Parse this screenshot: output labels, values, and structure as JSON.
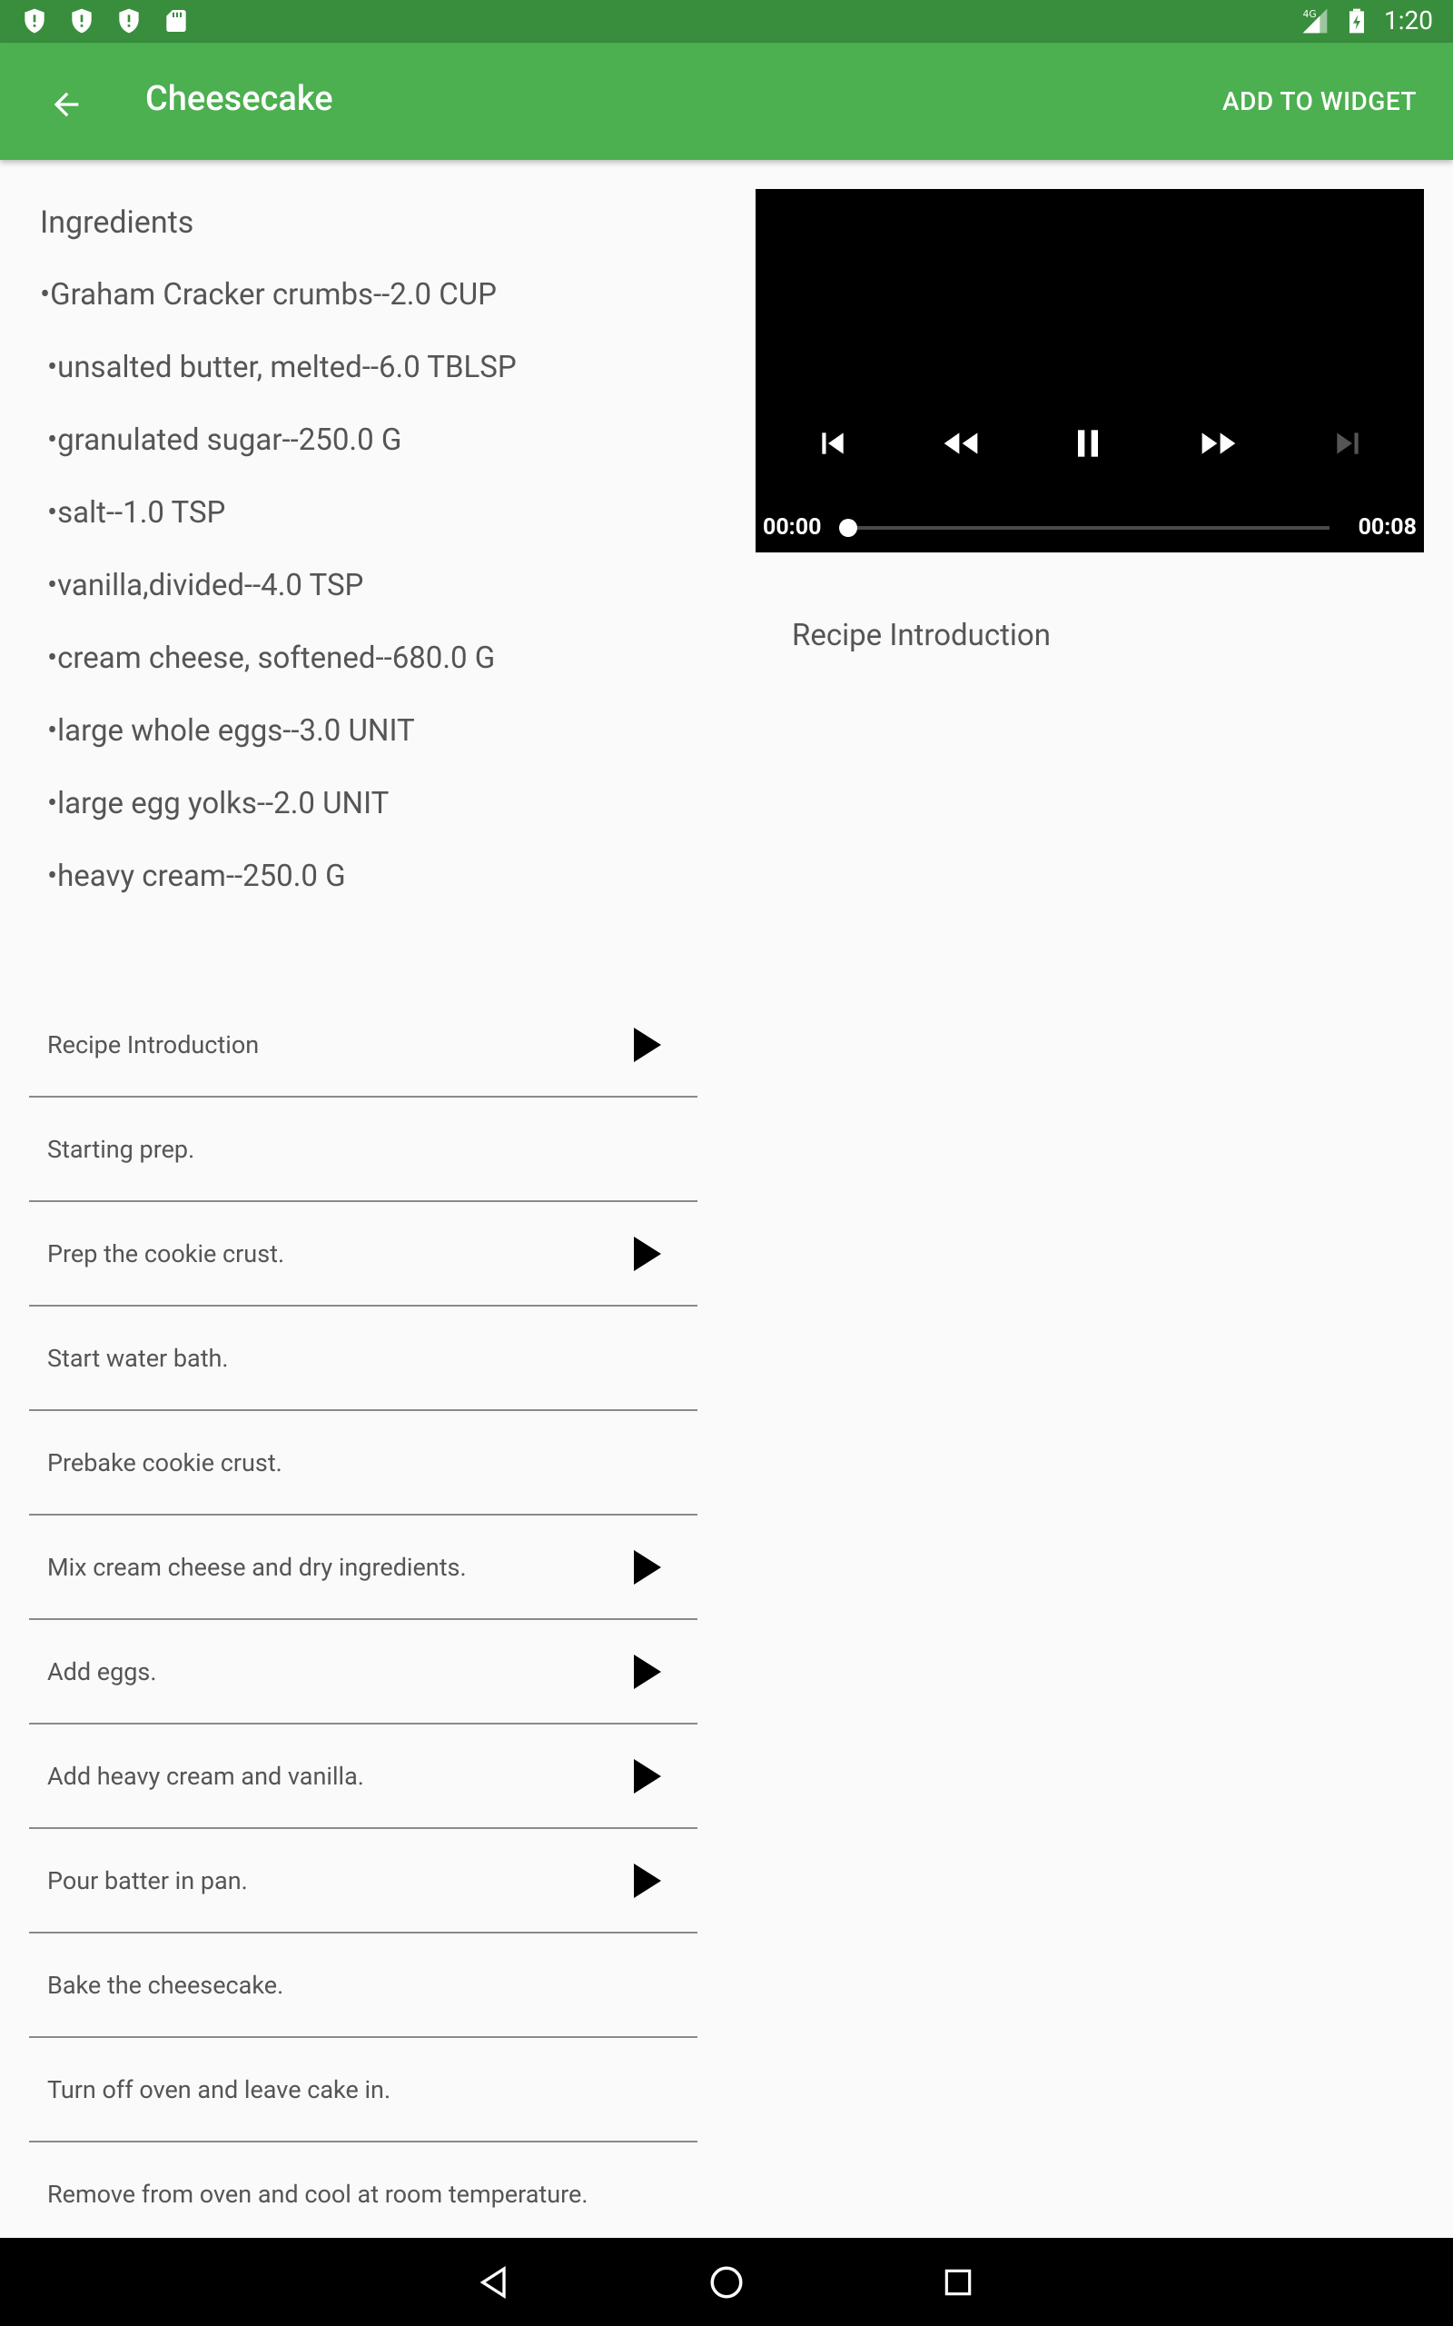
{
  "status_bar": {
    "time": "1:20",
    "network": "4G"
  },
  "toolbar": {
    "title": "Cheesecake",
    "action_label": "ADD TO WIDGET"
  },
  "ingredients": {
    "heading": "Ingredients",
    "items": [
      "•Graham Cracker crumbs--2.0 CUP",
      "•unsalted butter, melted--6.0 TBLSP",
      "•granulated sugar--250.0 G",
      "•salt--1.0 TSP",
      "•vanilla,divided--4.0 TSP",
      "•cream cheese, softened--680.0 G",
      "•large whole eggs--3.0 UNIT",
      "•large egg yolks--2.0 UNIT",
      "•heavy cream--250.0 G"
    ]
  },
  "steps": [
    {
      "label": "Recipe Introduction",
      "has_video": true
    },
    {
      "label": "Starting prep.",
      "has_video": false
    },
    {
      "label": "Prep the cookie crust.",
      "has_video": true
    },
    {
      "label": "Start water bath.",
      "has_video": false
    },
    {
      "label": "Prebake cookie crust.",
      "has_video": false
    },
    {
      "label": "Mix cream cheese and dry ingredients.",
      "has_video": true
    },
    {
      "label": "Add eggs.",
      "has_video": true
    },
    {
      "label": "Add heavy cream and vanilla.",
      "has_video": true
    },
    {
      "label": "Pour batter in pan.",
      "has_video": true
    },
    {
      "label": "Bake the cheesecake.",
      "has_video": false
    },
    {
      "label": "Turn off oven and leave cake in.",
      "has_video": false
    },
    {
      "label": "Remove from oven and cool at room temperature.",
      "has_video": false
    }
  ],
  "player": {
    "position": "00:00",
    "duration": "00:08",
    "progress_fraction": 0.0
  },
  "step_description": "Recipe Introduction",
  "colors": {
    "status_bar": "#388e3c",
    "toolbar": "#4caf50",
    "background": "#fafafa",
    "text": "#555555"
  }
}
